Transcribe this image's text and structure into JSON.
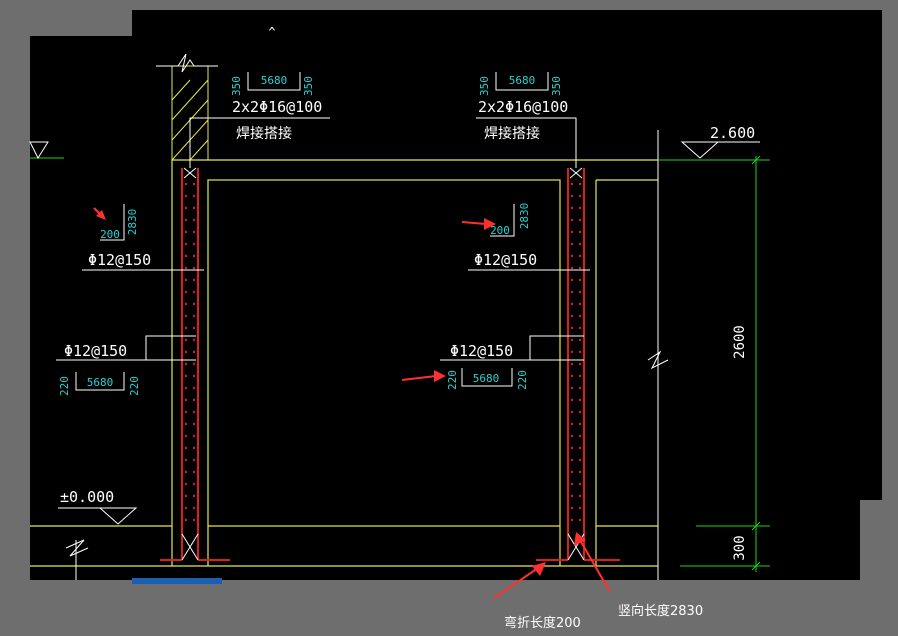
{
  "drawing": {
    "top_marker": "^",
    "left_top_rebar": {
      "left": "350",
      "mid": "5680",
      "right": "350",
      "spec": "2x2Φ16@100",
      "note": "焊接搭接"
    },
    "right_top_rebar": {
      "left": "350",
      "mid": "5680",
      "right": "350",
      "spec": "2x2Φ16@100",
      "note": "焊接搭接"
    },
    "elev_top": "2.600",
    "elev_zero": "±0.000",
    "dim_height": "2600",
    "dim_base": "300",
    "left_bend": {
      "bend": "200",
      "vertical": "2830"
    },
    "right_bend": {
      "bend": "200",
      "vertical": "2830"
    },
    "left_dist1": "Φ12@150",
    "right_dist1": "Φ12@150",
    "left_dist2": "Φ12@150",
    "right_dist2": "Φ12@150",
    "left_bottom_rebar": {
      "left": "220",
      "mid": "5680",
      "right": "220"
    },
    "right_bottom_rebar": {
      "left": "220",
      "mid": "5680",
      "right": "220"
    }
  },
  "annotations": {
    "bend_length": "弯折长度200",
    "vertical_length": "竖向长度2830"
  },
  "colors": {
    "background": "#000000",
    "frame": "#6e6e6e",
    "wall": "#e8e84a",
    "text": "#ffffff",
    "dim": "#27d3d3",
    "rebar": "#d82020",
    "green": "#20d020",
    "arrow": "#ff3030"
  }
}
